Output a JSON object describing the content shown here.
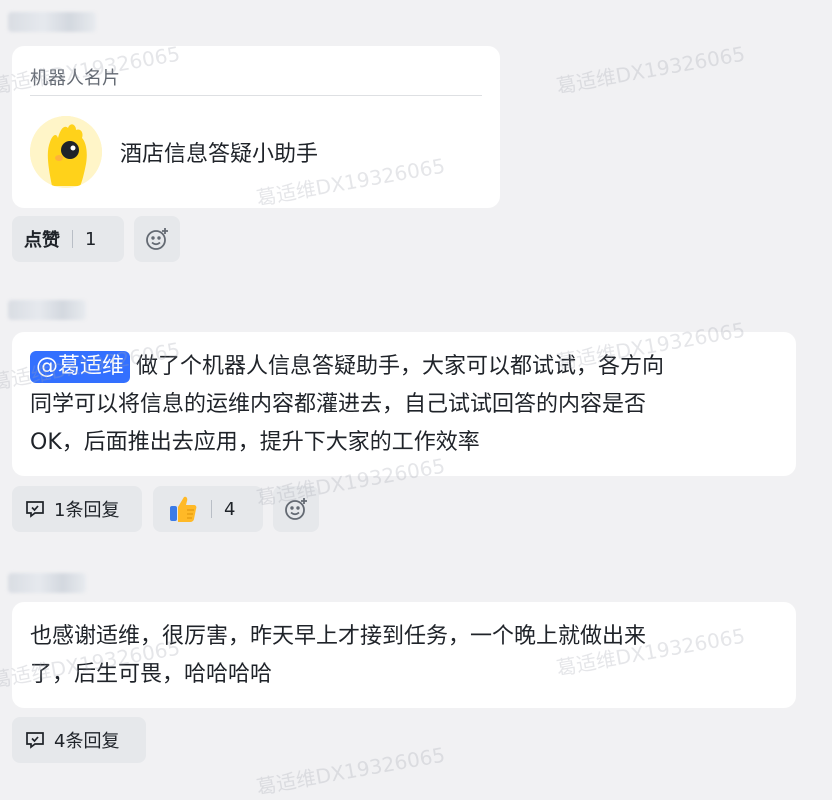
{
  "bot_card": {
    "title": "机器人名片",
    "bot_name": "酒店信息答疑小助手",
    "like_label": "点赞",
    "like_count": "1"
  },
  "message1": {
    "mention": "@葛适维",
    "line1": "做了个机器人信息答疑助手，大家可以都试试，各方向",
    "line2": "同学可以将信息的运维内容都灌进去，自己试试回答的内容是否",
    "line3": "OK，后面推出去应用，提升下大家的工作效率",
    "reply_label": "1条回复",
    "thumbs_count": "4"
  },
  "message2": {
    "line1": "也感谢适维，很厉害，昨天早上才接到任务，一个晚上就做出来",
    "line2": "了，后生可畏，哈哈哈哈",
    "reply_label": "4条回复"
  },
  "watermark_text": "葛适维DX19326065",
  "icons": [
    "add-reaction-icon",
    "reply-icon",
    "thumbs-up-icon",
    "bot-avatar"
  ]
}
